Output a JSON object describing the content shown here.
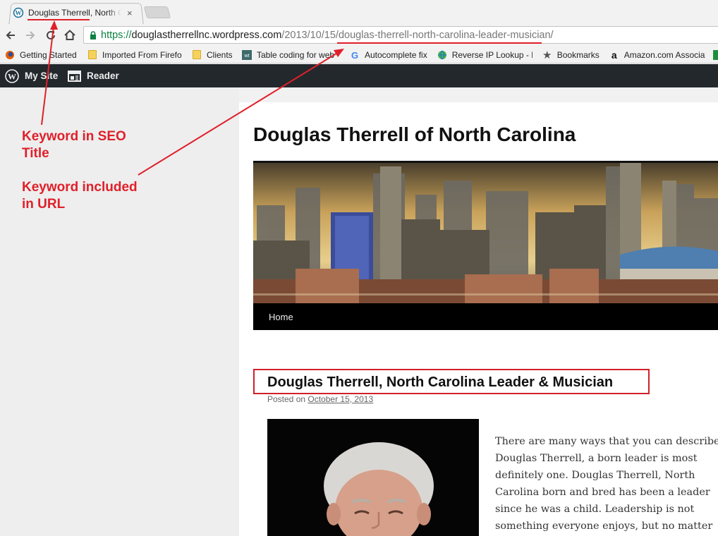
{
  "browser": {
    "tab": {
      "title": "Douglas Therrell, North Carolina Leader & Musician",
      "close_glyph": "×"
    },
    "omnibox": {
      "scheme": "https://",
      "host": "douglastherrellnc.wordpress.com",
      "path_date": "/2013/10/15/",
      "path_slug": "douglas-therrell-north-carolina-leader-musician/"
    },
    "bookmarks": [
      {
        "label": "Getting Started",
        "icon": "firefox-icon"
      },
      {
        "label": "Imported From Firefox",
        "icon": "folder-icon"
      },
      {
        "label": "Clients",
        "icon": "folder-icon"
      },
      {
        "label": "Table coding for web",
        "icon": "wt-icon"
      },
      {
        "label": "Autocomplete fix",
        "icon": "google-icon"
      },
      {
        "label": "Reverse IP Lookup - F",
        "icon": "globe-icon"
      },
      {
        "label": "Bookmarks",
        "icon": "star-icon"
      },
      {
        "label": "Amazon.com Associate",
        "icon": "amazon-icon"
      }
    ]
  },
  "adminbar": {
    "my_site": "My Site",
    "reader": "Reader"
  },
  "site": {
    "title": "Douglas Therrell of North Carolina",
    "menu_home": "Home"
  },
  "post": {
    "title": "Douglas Therrell, North Carolina Leader & Musician",
    "posted_on": "Posted on",
    "date": "October 15, 2013",
    "excerpt_lines": [
      "There are many ways that you can describe",
      "Douglas Therrell, a born leader is most",
      "definitely one. Douglas Therrell, North",
      "Carolina born and bred has been a leader",
      "since he was a child. Leadership is not",
      "something everyone enjoys, but no matter"
    ]
  },
  "annotations": {
    "seo_title": [
      "Keyword in SEO",
      "Title"
    ],
    "url": [
      "Keyword included",
      "in URL"
    ]
  },
  "colors": {
    "annotation": "#e0202a",
    "adminbar": "#23282d",
    "url_scheme": "#0b8043"
  }
}
